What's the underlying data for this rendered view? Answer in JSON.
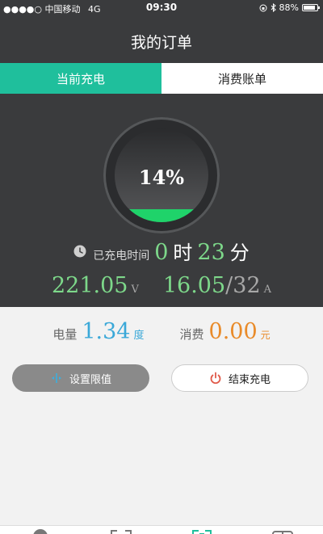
{
  "status_bar": {
    "signal_dots": "●●●●○",
    "carrier": "中国移动",
    "network": "4G",
    "time": "09:30",
    "battery": "88%",
    "battery_level": 0.88,
    "icons": [
      "lock-rotation-icon",
      "bluetooth-icon",
      "battery-icon"
    ]
  },
  "header": {
    "title": "我的订单"
  },
  "tabs": [
    {
      "label": "当前充电",
      "active": true
    },
    {
      "label": "消费账单",
      "active": false
    }
  ],
  "gauge": {
    "percent_text": "14%",
    "level": 0.14,
    "fill_color": "#1fd36a"
  },
  "charge_time": {
    "label": "已充电时间",
    "hours": "0",
    "hours_unit": "时",
    "minutes": "23",
    "minutes_unit": "分"
  },
  "meters": {
    "voltage": "221.05",
    "voltage_unit": "V",
    "current": "16.05",
    "current_separator": "/",
    "current_max": "32",
    "current_unit": "A"
  },
  "energy": {
    "label": "电量",
    "value": "1.34",
    "unit": "度",
    "cost_label": "消费",
    "cost_value": "0.00",
    "cost_unit": "元"
  },
  "actions": {
    "set_limit_label": "设置限值",
    "end_charge_label": "结束充电"
  },
  "colors": {
    "accent": "#1fbf9c",
    "energy_blue": "#3aa8d8",
    "cost_orange": "#e98b2a",
    "value_green": "#7dd88a",
    "end_icon_red": "#e05a4a"
  }
}
